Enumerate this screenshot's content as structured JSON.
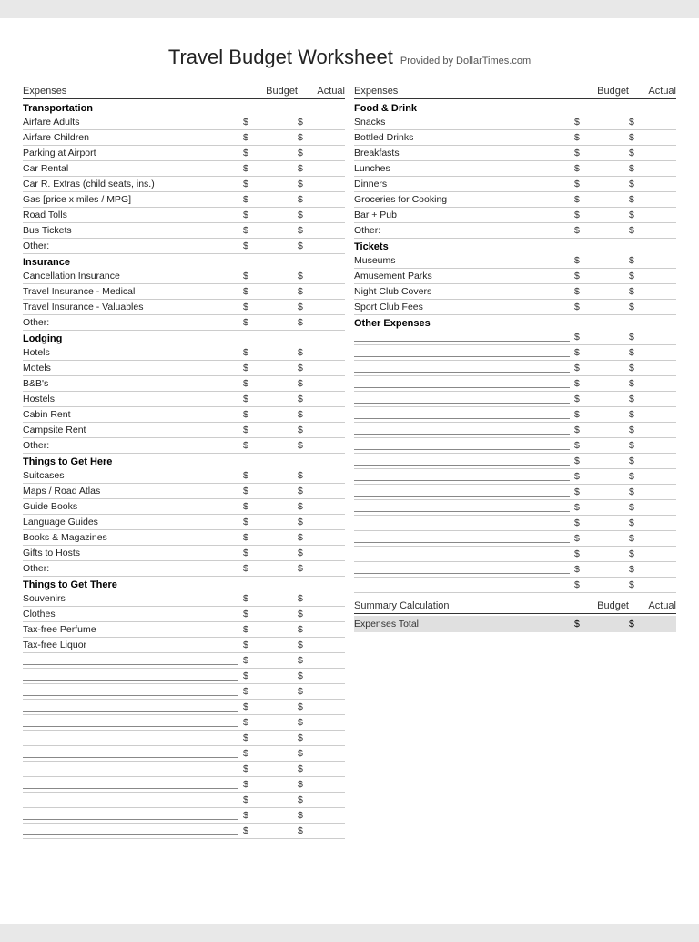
{
  "title": "Travel Budget Worksheet",
  "subtitle": "Provided by DollarTimes.com",
  "header": {
    "expenses": "Expenses",
    "budget": "Budget",
    "actual": "Actual"
  },
  "left_column": {
    "sections": [
      {
        "title": "Transportation",
        "items": [
          "Airfare Adults",
          "Airfare Children",
          "Parking at Airport",
          "Car Rental",
          "Car R. Extras (child seats, ins.)",
          "Gas [price x miles / MPG]",
          "Road Tolls",
          "Bus Tickets",
          "Other:"
        ]
      },
      {
        "title": "Insurance",
        "items": [
          "Cancellation Insurance",
          "Travel Insurance - Medical",
          "Travel Insurance - Valuables",
          "Other:"
        ]
      },
      {
        "title": "Lodging",
        "items": [
          "Hotels",
          "Motels",
          "B&B's",
          "Hostels",
          "Cabin Rent",
          "Campsite Rent",
          "Other:"
        ]
      },
      {
        "title": "Things to Get Here",
        "items": [
          "Suitcases",
          "Maps / Road Atlas",
          "Guide Books",
          "Language Guides",
          "Books & Magazines",
          "Gifts to Hosts",
          "Other:"
        ]
      },
      {
        "title": "Things to Get There",
        "items": [
          "Souvenirs",
          "Clothes",
          "Tax-free Perfume",
          "Tax-free Liquor"
        ]
      }
    ],
    "empty_rows": 12
  },
  "right_column": {
    "sections": [
      {
        "title": "Food & Drink",
        "items": [
          "Snacks",
          "Bottled Drinks",
          "Breakfasts",
          "Lunches",
          "Dinners",
          "Groceries for Cooking",
          "Bar + Pub",
          "Other:"
        ]
      },
      {
        "title": "Tickets",
        "items": [
          "Museums",
          "Amusement Parks",
          "Night Club Covers",
          "Sport Club Fees"
        ]
      },
      {
        "title": "Other Expenses",
        "items": []
      }
    ],
    "other_empty_rows": 17,
    "summary": {
      "label": "Summary Calculation",
      "budget_label": "Budget",
      "actual_label": "Actual",
      "row_label": "Expenses Total",
      "dollar": "$"
    }
  },
  "dollar_sign": "$"
}
